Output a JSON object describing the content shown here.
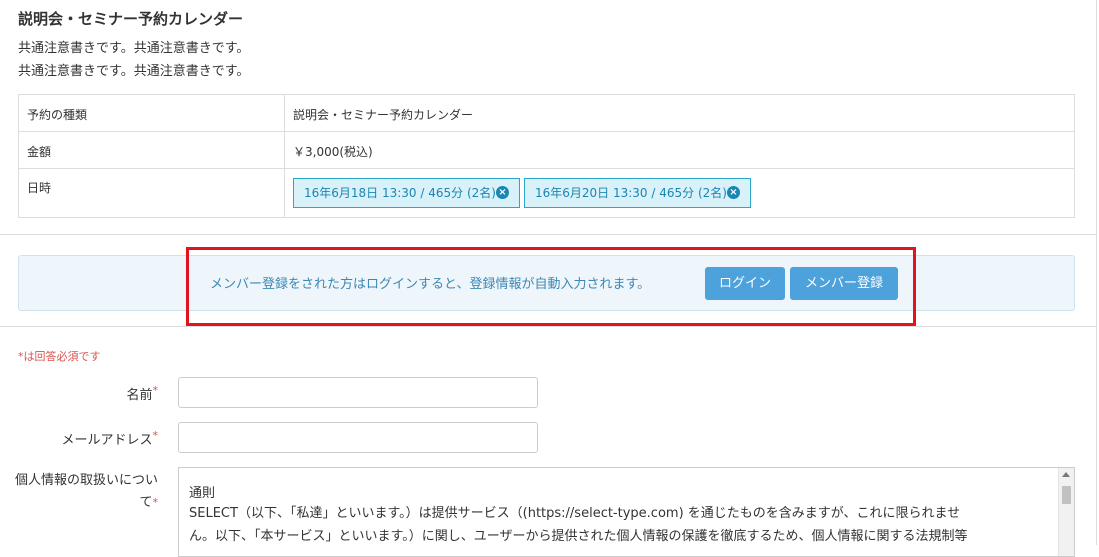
{
  "page": {
    "title": "説明会・セミナー予約カレンダー",
    "notes": [
      "共通注意書きです。共通注意書きです。",
      "共通注意書きです。共通注意書きです。"
    ]
  },
  "info": {
    "rows": [
      {
        "label": "予約の種類",
        "value": "説明会・セミナー予約カレンダー"
      },
      {
        "label": "金額",
        "value": "￥3,000(税込)"
      },
      {
        "label": "日時",
        "value": ""
      }
    ],
    "dates": [
      "16年6月18日 13:30 / 465分 (2名)",
      "16年6月20日 13:30 / 465分 (2名)"
    ],
    "remove_icon": "×"
  },
  "login_bar": {
    "message": "メンバー登録をされた方はログインすると、登録情報が自動入力されます。",
    "login_label": "ログイン",
    "register_label": "メンバー登録"
  },
  "form": {
    "required_note": "*は回答必須です",
    "required_mark": "*",
    "name_label": "名前",
    "email_label": "メールアドレス",
    "privacy_label": "個人情報の取扱いについて",
    "name_value": "",
    "email_value": "",
    "policy": {
      "heading": "通則",
      "lines": [
        "SELECT（以下、「私達」といいます。）は提供サービス（(https://select-type.com) を通じたものを含みますが、これに限られませ",
        "ん。以下、「本サービス」といいます。）に関し、ユーザーから提供された個人情報の保護を徹底するため、個人情報に関する法規制等"
      ]
    }
  },
  "colors": {
    "accent": "#4ea2dc",
    "highlight": "#e0141e",
    "required": "#d9534f",
    "tag_border": "#2aa7c9"
  }
}
